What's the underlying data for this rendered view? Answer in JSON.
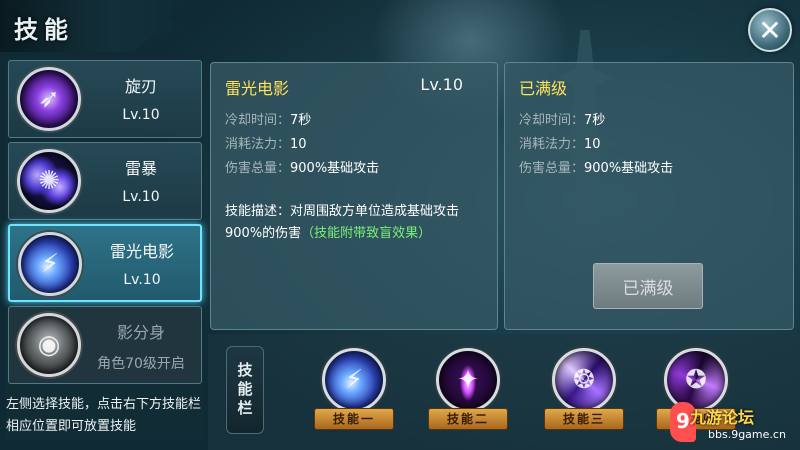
{
  "header": {
    "title": "技能",
    "close_label": "✕"
  },
  "skills": [
    {
      "name": "旋刃",
      "level": "Lv.10",
      "icon": "whirl-blade-icon"
    },
    {
      "name": "雷暴",
      "level": "Lv.10",
      "icon": "thunderstorm-icon"
    },
    {
      "name": "雷光电影",
      "level": "Lv.10",
      "icon": "lightning-shadow-icon",
      "selected": true
    },
    {
      "name": "影分身",
      "level": "角色70级开启",
      "icon": "shadow-clone-icon",
      "locked": true
    }
  ],
  "hint": "左侧选择技能，点击右下方技能栏相应位置即可放置技能",
  "current": {
    "title": "雷光电影",
    "level": "Lv.10",
    "cooldown_label": "冷却时间：",
    "cooldown": "7秒",
    "mana_label": "消耗法力：",
    "mana": "10",
    "damage_label": "伤害总量：",
    "damage": "900%基础攻击",
    "desc_label": "技能描述：",
    "desc_text": "对周围敌方单位造成基础攻击900%的伤害",
    "desc_extra": "（技能附带致盲效果）"
  },
  "next": {
    "title": "已满级",
    "cooldown_label": "冷却时间：",
    "cooldown": "7秒",
    "mana_label": "消耗法力：",
    "mana": "10",
    "damage_label": "伤害总量：",
    "damage": "900%基础攻击",
    "button_label": "已满级"
  },
  "skill_bar": {
    "label": "技能栏",
    "slots": [
      {
        "tag": "技能一",
        "icon": "lightning-shadow-icon"
      },
      {
        "tag": "技能二",
        "icon": "purple-pillar-icon"
      },
      {
        "tag": "技能三",
        "icon": "vortex-icon"
      },
      {
        "tag": "技能四",
        "icon": "dark-swirl-icon"
      }
    ]
  },
  "watermark": {
    "logo": "9",
    "brand": "九游论坛",
    "url": "bbs.9game.cn"
  }
}
